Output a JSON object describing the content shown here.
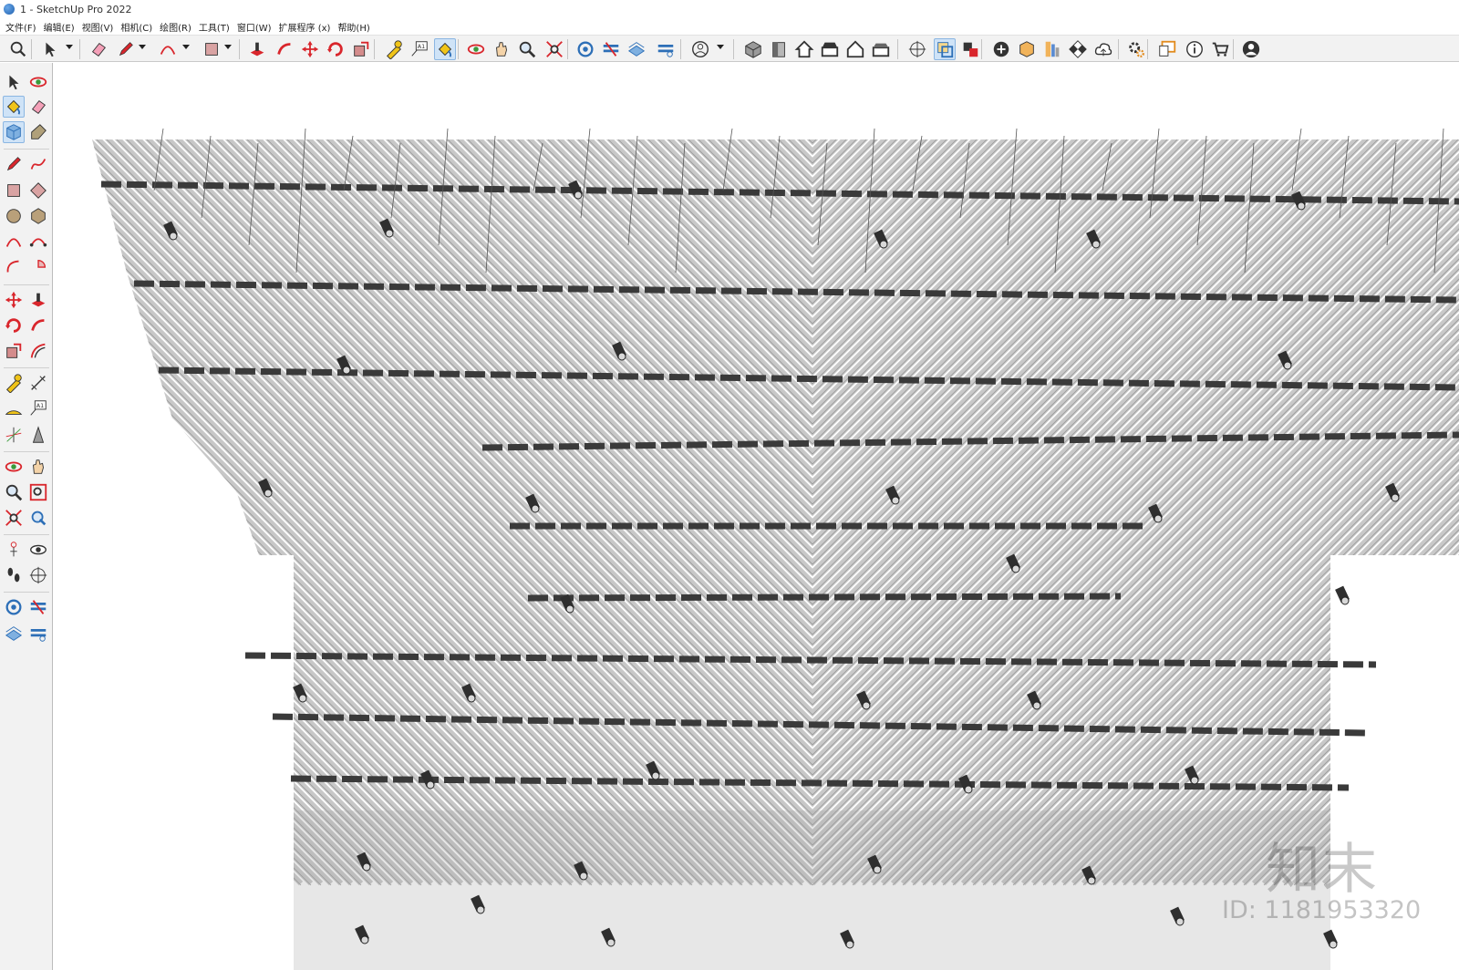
{
  "window": {
    "title": "1 - SketchUp Pro 2022"
  },
  "menu": [
    "文件(F)",
    "编辑(E)",
    "视图(V)",
    "相机(C)",
    "绘图(R)",
    "工具(T)",
    "窗口(W)",
    "扩展程序 (x)",
    "帮助(H)"
  ],
  "toolbar_icons": [
    "search-icon",
    "select-icon",
    "eraser-icon",
    "pencil-icon",
    "arc-icon",
    "rectangle-icon",
    "push-pull-icon",
    "follow-me-icon",
    "move-icon",
    "rotate-icon",
    "scale-icon",
    "tape-measure-icon",
    "text-icon",
    "paint-bucket-icon",
    "orbit-icon",
    "pan-icon",
    "zoom-icon",
    "zoom-extents-icon",
    "warehouse-icon",
    "extension-warehouse-icon",
    "sandbox-icon",
    "layers-icon",
    "account-icon",
    "iso-view-icon",
    "front-view-icon",
    "home-view-icon",
    "top-view-icon",
    "right-view-icon",
    "back-view-icon",
    "section-plane-icon",
    "section-display-icon",
    "section-fill-icon",
    "add-location-icon",
    "terrain-icon",
    "photo-texture-icon",
    "checker-icon",
    "cloud-upload-icon",
    "settings-icon",
    "dialog-icon",
    "info-icon",
    "cart-icon",
    "profile-icon"
  ],
  "left_toolbar_icons": [
    "select-icon",
    "orbit-icon",
    "paint-bucket-icon",
    "eraser-icon",
    "component-icon",
    "tag-icon",
    "pencil-icon",
    "freehand-icon",
    "rectangle-icon",
    "rotated-rectangle-icon",
    "circle-icon",
    "polygon-icon",
    "arc-icon",
    "2-point-arc-icon",
    "3-point-arc-icon",
    "pie-icon",
    "move-icon",
    "push-pull-icon",
    "rotate-icon",
    "follow-me-icon",
    "scale-icon",
    "offset-icon",
    "tape-measure-icon",
    "dimension-icon",
    "protractor-icon",
    "text-icon",
    "axes-icon",
    "3d-text-icon",
    "orbit-2-icon",
    "pan-icon",
    "zoom-icon",
    "zoom-window-icon",
    "zoom-extents-icon",
    "previous-view-icon",
    "position-camera-icon",
    "look-around-icon",
    "walk-icon",
    "section-plane-icon",
    "warehouse-icon",
    "extension-icon",
    "sandbox-icon",
    "layers-icon"
  ],
  "watermark": {
    "brand": "知末",
    "id": "ID: 1181953320"
  },
  "colors": {
    "panel": "#f2f2f2",
    "accent_active": "#cfe3f7",
    "slat": "#c8c8c8",
    "slat_edge": "#9a9a9a",
    "beam": "#3a3a3a",
    "viewport": "#ffffff"
  }
}
